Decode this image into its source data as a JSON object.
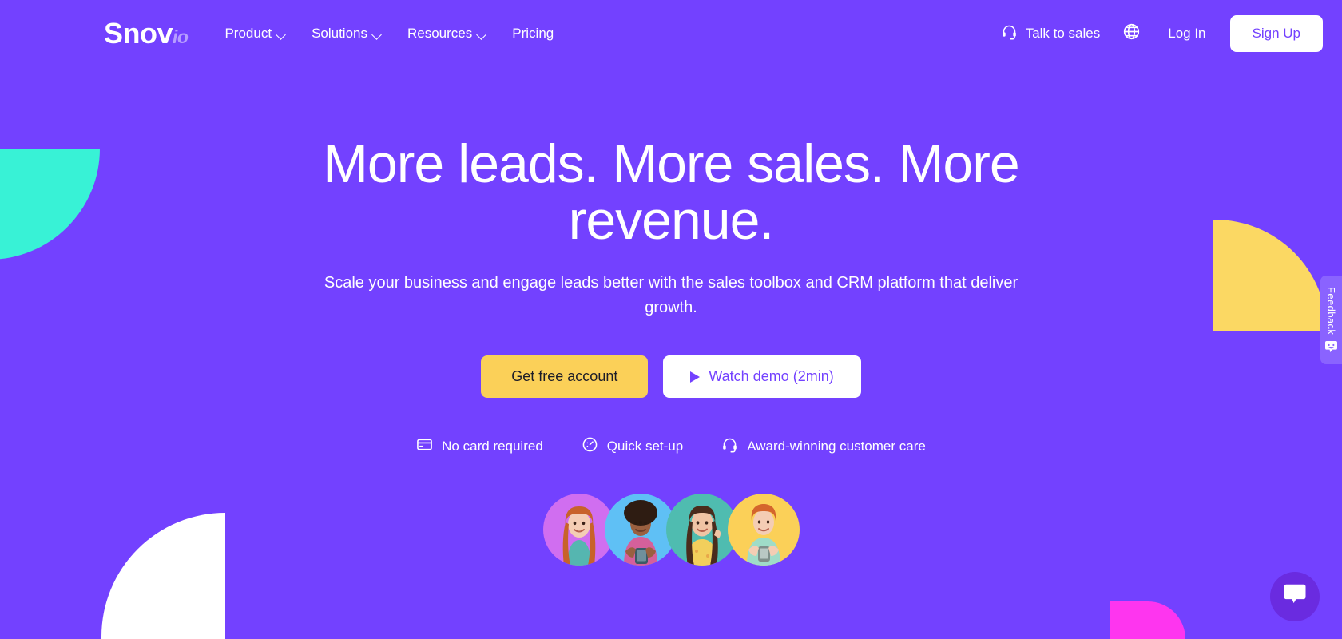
{
  "theme": {
    "background": "#7341ff",
    "accent_yellow": "#fbd058",
    "accent_white": "#ffffff",
    "accent_teal": "#38f2d6",
    "accent_pink": "#fe35ef",
    "logo_sub_color": "#b69dff",
    "feedback_tab_bg": "#8a63ff",
    "chat_fab_bg": "#6a2be0"
  },
  "header": {
    "logo": {
      "main": "Snov",
      "sub": "io"
    },
    "nav": [
      {
        "label": "Product",
        "has_dropdown": true
      },
      {
        "label": "Solutions",
        "has_dropdown": true
      },
      {
        "label": "Resources",
        "has_dropdown": true
      },
      {
        "label": "Pricing",
        "has_dropdown": false
      }
    ],
    "talk_to_sales": "Talk to sales",
    "language_icon": "globe-icon",
    "login": "Log In",
    "signup": "Sign Up"
  },
  "hero": {
    "title": "More leads. More sales. More revenue.",
    "subtitle": "Scale your business and engage leads better with the sales toolbox and CRM platform that deliver growth.",
    "primary_cta": "Get free account",
    "secondary_cta": "Watch demo (2min)",
    "features": [
      {
        "icon": "credit-card-icon",
        "label": "No card required"
      },
      {
        "icon": "speedometer-icon",
        "label": "Quick set-up"
      },
      {
        "icon": "headset-icon",
        "label": "Award-winning customer care"
      }
    ],
    "avatars": [
      {
        "name": "avatar-1",
        "bg": "#d06ef0",
        "skin": "#f4cdb4",
        "hair": "#c8622a",
        "shirt": "#55b6b0"
      },
      {
        "name": "avatar-2",
        "bg": "#5fc0f5",
        "skin": "#9a6040",
        "hair": "#2e1c12",
        "shirt": "#d4609b"
      },
      {
        "name": "avatar-3",
        "bg": "#4fbcb0",
        "skin": "#f0c4a4",
        "hair": "#4a2c1c",
        "shirt": "#f2cf5c"
      },
      {
        "name": "avatar-4",
        "bg": "#fbd058",
        "skin": "#f4cdb4",
        "hair": "#d4652c",
        "shirt": "#9fdcc8"
      }
    ]
  },
  "widgets": {
    "feedback_label": "Feedback",
    "feedback_icon": "smiley-speech-bubble-icon",
    "chat_icon": "chat-bubble-icon"
  }
}
